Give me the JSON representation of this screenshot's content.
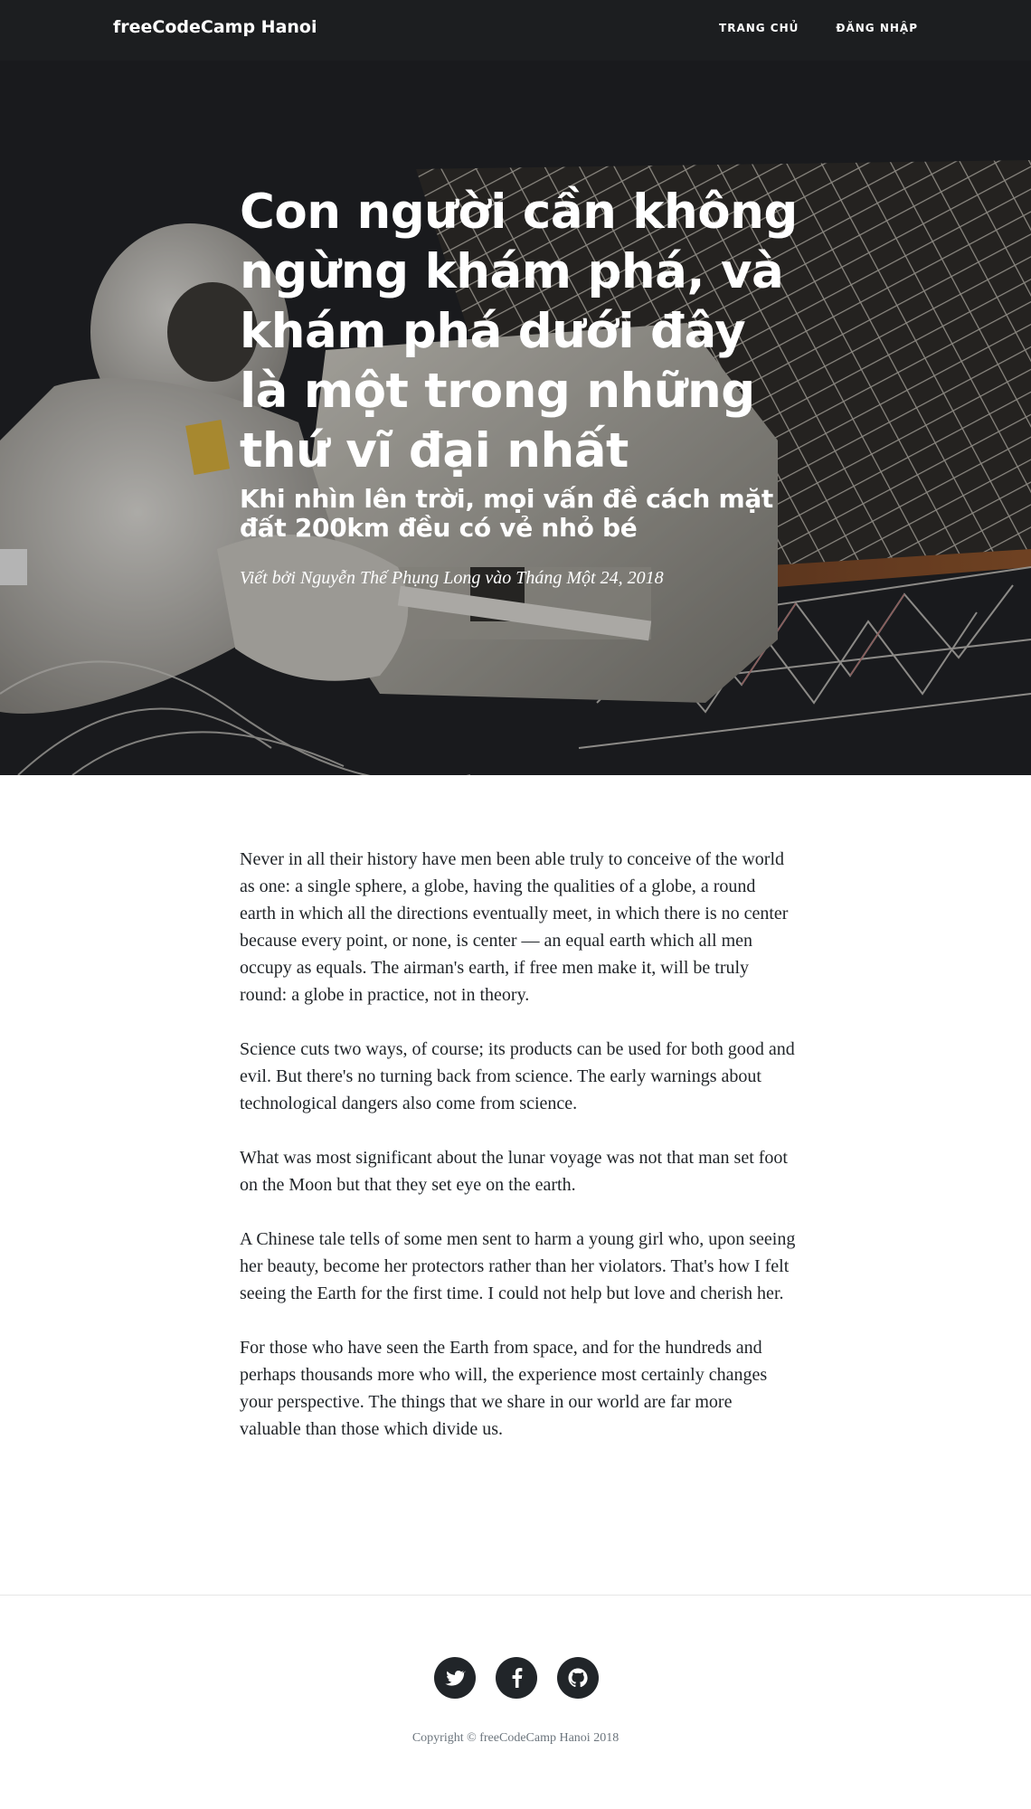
{
  "nav": {
    "brand": "freeCodeCamp Hanoi",
    "links": [
      "TRANG CHỦ",
      "ĐĂNG NHẬP"
    ]
  },
  "hero": {
    "title": "Con người cần không ngừng khám phá, và khám phá dưới đây là một trong những thứ vĩ đại nhất",
    "subtitle": "Khi nhìn lên trời, mọi vấn đề cách mặt đất 200km đều có vẻ nhỏ bé",
    "meta": "Viết bởi Nguyễn Thế Phụng Long vào Tháng Một 24, 2018"
  },
  "article": {
    "paragraphs": [
      "Never in all their history have men been able truly to conceive of the world as one: a single sphere, a globe, having the qualities of a globe, a round earth in which all the directions eventually meet, in which there is no center because every point, or none, is center — an equal earth which all men occupy as equals. The airman's earth, if free men make it, will be truly round: a globe in practice, not in theory.",
      "Science cuts two ways, of course; its products can be used for both good and evil. But there's no turning back from science. The early warnings about technological dangers also come from science.",
      "What was most significant about the lunar voyage was not that man set foot on the Moon but that they set eye on the earth.",
      "A Chinese tale tells of some men sent to harm a young girl who, upon seeing her beauty, become her protectors rather than her violators. That's how I felt seeing the Earth for the first time. I could not help but love and cherish her.",
      "For those who have seen the Earth from space, and for the hundreds and perhaps thousands more who will, the experience most certainly changes your perspective. The things that we share in our world are far more valuable than those which divide us."
    ]
  },
  "footer": {
    "social": [
      "twitter-icon",
      "facebook-icon",
      "github-icon"
    ],
    "copyright": "Copyright © freeCodeCamp Hanoi 2018"
  },
  "colors": {
    "navbar": "#1c1e20",
    "social_bg": "#212529",
    "text": "#212529",
    "muted": "#6c757d"
  }
}
